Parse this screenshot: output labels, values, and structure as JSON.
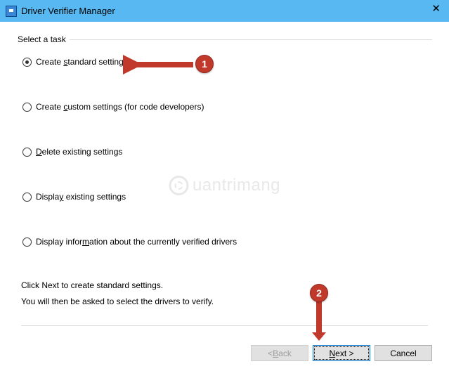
{
  "title": "Driver Verifier Manager",
  "group_label": "Select a task",
  "options": {
    "opt1_pre": "Create ",
    "opt1_mn": "s",
    "opt1_post": "tandard settings",
    "opt2_pre": "Create ",
    "opt2_mn": "c",
    "opt2_post": "ustom settings (for code developers)",
    "opt3_mn": "D",
    "opt3_post": "elete existing settings",
    "opt4_pre": "Displa",
    "opt4_mn": "y",
    "opt4_post": " existing settings",
    "opt5_pre": "Display infor",
    "opt5_mn": "m",
    "opt5_post": "ation about the currently verified drivers"
  },
  "hint_line1": "Click Next to create standard settings.",
  "hint_line2": "You will then be asked to select the drivers to verify.",
  "buttons": {
    "back_pre": "< ",
    "back_mn": "B",
    "back_post": "ack",
    "next_mn": "N",
    "next_post": "ext >",
    "cancel": "Cancel"
  },
  "annotations": {
    "badge1": "1",
    "badge2": "2"
  },
  "watermark": "uantrimang"
}
